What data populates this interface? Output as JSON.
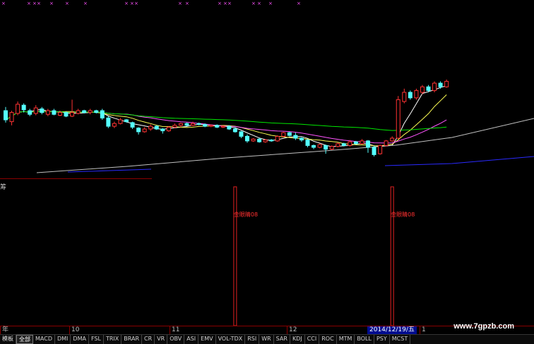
{
  "indicator_label": "筹",
  "signal_text": "金眼睛08",
  "timeline": {
    "months": [
      "10",
      "11",
      "12"
    ],
    "cursor_date": "2014/12/19/五",
    "cursor_suffix": "1"
  },
  "tabs": [
    "模板",
    "全部",
    "MACD",
    "DMI",
    "DMA",
    "FSL",
    "TRIX",
    "BRAR",
    "CR",
    "VR",
    "OBV",
    "ASI",
    "EMV",
    "VOL-TDX",
    "RSI",
    "WR",
    "SAR",
    "KDJ",
    "CCI",
    "ROC",
    "MTM",
    "BOLL",
    "PSY",
    "MCST"
  ],
  "active_tab": "全部",
  "watermark": "www.7gpzb.com",
  "colors": {
    "up": "#ff3232",
    "down": "#54ffff",
    "ma_short": "#ffffff",
    "ma_mid": "#ffff54",
    "ma_long": "#ff54ff",
    "ma_longer": "#00e600",
    "ma_longest": "#c0c0c0",
    "ma_bottom": "#2a2aff"
  },
  "chart_data": {
    "type": "candlestick",
    "candles": [
      {
        "o": 60,
        "c": 50,
        "h": 64,
        "l": 47
      },
      {
        "o": 48,
        "c": 58,
        "h": 60,
        "l": 44
      },
      {
        "o": 57,
        "c": 67,
        "h": 70,
        "l": 55
      },
      {
        "o": 66,
        "c": 61,
        "h": 68,
        "l": 58
      },
      {
        "o": 60,
        "c": 56,
        "h": 62,
        "l": 54
      },
      {
        "o": 57,
        "c": 63,
        "h": 66,
        "l": 55
      },
      {
        "o": 62,
        "c": 58,
        "h": 64,
        "l": 56
      },
      {
        "o": 56,
        "c": 60,
        "h": 62,
        "l": 54
      },
      {
        "o": 60,
        "c": 56,
        "h": 62,
        "l": 55
      },
      {
        "o": 55,
        "c": 58,
        "h": 60,
        "l": 54
      },
      {
        "o": 58,
        "c": 54,
        "h": 59,
        "l": 53
      },
      {
        "o": 54,
        "c": 58,
        "h": 72,
        "l": 53
      },
      {
        "o": 57,
        "c": 60,
        "h": 62,
        "l": 56
      },
      {
        "o": 60,
        "c": 58,
        "h": 61,
        "l": 57
      },
      {
        "o": 58,
        "c": 60,
        "h": 62,
        "l": 56
      },
      {
        "o": 60,
        "c": 58,
        "h": 61,
        "l": 57
      },
      {
        "o": 60,
        "c": 52,
        "h": 62,
        "l": 50
      },
      {
        "o": 52,
        "c": 43,
        "h": 54,
        "l": 41
      },
      {
        "o": 43,
        "c": 46,
        "h": 48,
        "l": 41
      },
      {
        "o": 46,
        "c": 50,
        "h": 52,
        "l": 45
      },
      {
        "o": 50,
        "c": 48,
        "h": 51,
        "l": 47
      },
      {
        "o": 47,
        "c": 42,
        "h": 48,
        "l": 40
      },
      {
        "o": 41,
        "c": 37,
        "h": 42,
        "l": 34
      },
      {
        "o": 37,
        "c": 40,
        "h": 42,
        "l": 36
      },
      {
        "o": 40,
        "c": 43,
        "h": 45,
        "l": 38
      },
      {
        "o": 43,
        "c": 40,
        "h": 44,
        "l": 39
      },
      {
        "o": 40,
        "c": 38,
        "h": 41,
        "l": 35
      },
      {
        "o": 38,
        "c": 42,
        "h": 43,
        "l": 37
      },
      {
        "o": 42,
        "c": 44,
        "h": 46,
        "l": 41
      },
      {
        "o": 44,
        "c": 46,
        "h": 47,
        "l": 42
      },
      {
        "o": 46,
        "c": 44,
        "h": 47,
        "l": 43
      },
      {
        "o": 44,
        "c": 46,
        "h": 48,
        "l": 43
      },
      {
        "o": 46,
        "c": 45,
        "h": 47,
        "l": 44
      },
      {
        "o": 45,
        "c": 43,
        "h": 46,
        "l": 42
      },
      {
        "o": 43,
        "c": 44,
        "h": 45,
        "l": 42
      },
      {
        "o": 44,
        "c": 42,
        "h": 45,
        "l": 41
      },
      {
        "o": 42,
        "c": 43,
        "h": 44,
        "l": 41
      },
      {
        "o": 43,
        "c": 40,
        "h": 44,
        "l": 39
      },
      {
        "o": 40,
        "c": 37,
        "h": 42,
        "l": 36
      },
      {
        "o": 37,
        "c": 32,
        "h": 38,
        "l": 30
      },
      {
        "o": 32,
        "c": 27,
        "h": 34,
        "l": 25
      },
      {
        "o": 27,
        "c": 29,
        "h": 30,
        "l": 26
      },
      {
        "o": 29,
        "c": 26,
        "h": 30,
        "l": 25
      },
      {
        "o": 26,
        "c": 28,
        "h": 29,
        "l": 25
      },
      {
        "o": 28,
        "c": 27,
        "h": 29,
        "l": 26
      },
      {
        "o": 27,
        "c": 32,
        "h": 33,
        "l": 26
      },
      {
        "o": 32,
        "c": 36,
        "h": 37,
        "l": 31
      },
      {
        "o": 36,
        "c": 33,
        "h": 37,
        "l": 32
      },
      {
        "o": 33,
        "c": 30,
        "h": 36,
        "l": 28
      },
      {
        "o": 30,
        "c": 28,
        "h": 31,
        "l": 26
      },
      {
        "o": 28,
        "c": 22,
        "h": 29,
        "l": 20
      },
      {
        "o": 22,
        "c": 20,
        "h": 23,
        "l": 18
      },
      {
        "o": 20,
        "c": 23,
        "h": 24,
        "l": 19
      },
      {
        "o": 22,
        "c": 18,
        "h": 23,
        "l": 13
      },
      {
        "o": 18,
        "c": 21,
        "h": 22,
        "l": 17
      },
      {
        "o": 21,
        "c": 24,
        "h": 25,
        "l": 20
      },
      {
        "o": 24,
        "c": 22,
        "h": 25,
        "l": 21
      },
      {
        "o": 22,
        "c": 26,
        "h": 28,
        "l": 21
      },
      {
        "o": 26,
        "c": 24,
        "h": 27,
        "l": 23
      },
      {
        "o": 24,
        "c": 27,
        "h": 29,
        "l": 23
      },
      {
        "o": 27,
        "c": 20,
        "h": 28,
        "l": 14
      },
      {
        "o": 20,
        "c": 12,
        "h": 22,
        "l": 10
      },
      {
        "o": 13,
        "c": 22,
        "h": 23,
        "l": 12
      },
      {
        "o": 22,
        "c": 27,
        "h": 28,
        "l": 21
      },
      {
        "o": 27,
        "c": 30,
        "h": 32,
        "l": 26
      },
      {
        "o": 30,
        "c": 72,
        "h": 76,
        "l": 29
      },
      {
        "o": 70,
        "c": 80,
        "h": 84,
        "l": 68
      },
      {
        "o": 80,
        "c": 74,
        "h": 82,
        "l": 72
      },
      {
        "o": 74,
        "c": 82,
        "h": 84,
        "l": 72
      },
      {
        "o": 80,
        "c": 86,
        "h": 88,
        "l": 78
      },
      {
        "o": 86,
        "c": 82,
        "h": 88,
        "l": 80
      },
      {
        "o": 82,
        "c": 90,
        "h": 92,
        "l": 80
      },
      {
        "o": 90,
        "c": 86,
        "h": 92,
        "l": 84
      },
      {
        "o": 86,
        "c": 92,
        "h": 94,
        "l": 85
      }
    ],
    "ylim": [
      0,
      100
    ],
    "signal_indices": [
      38,
      64
    ],
    "x_labels": [
      "10",
      "11",
      "12"
    ]
  }
}
